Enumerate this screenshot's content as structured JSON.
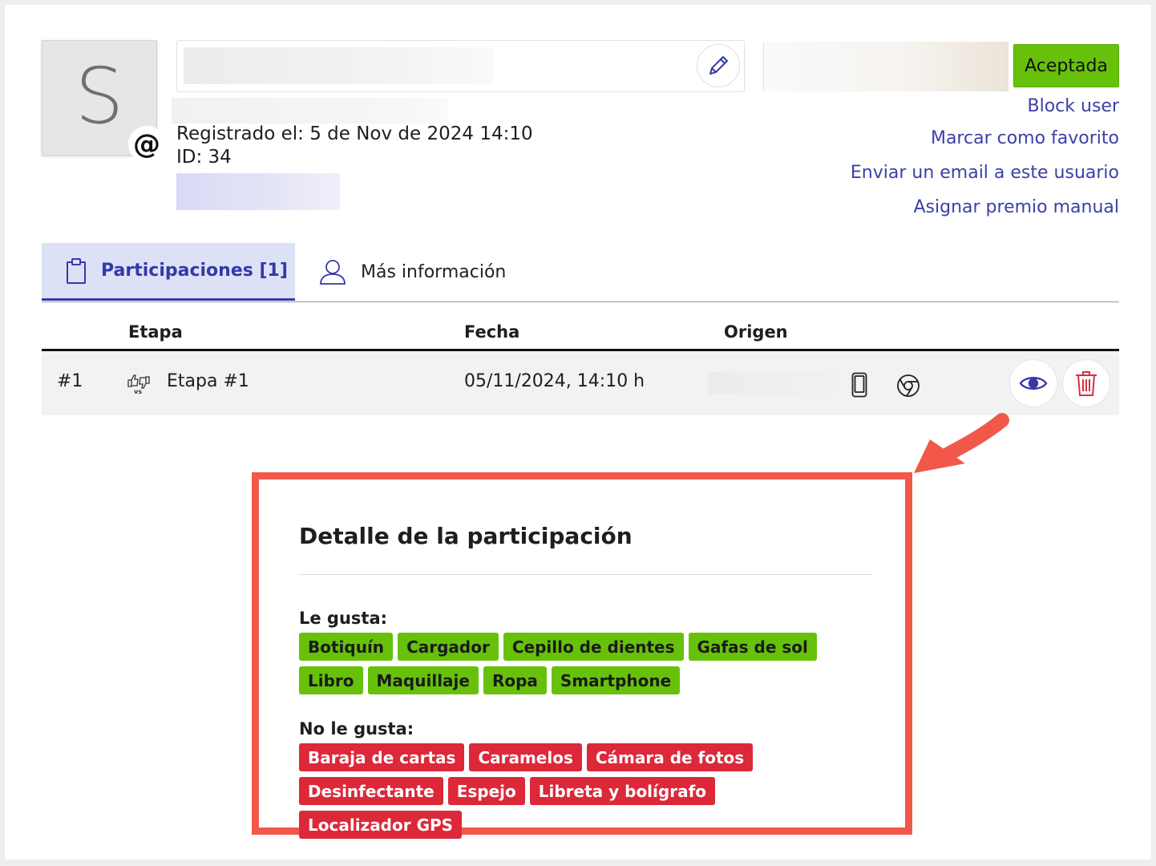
{
  "profile": {
    "avatar_letter": "S",
    "email_badge": "@",
    "registered": "Registrado el: 5 de Nov de 2024 14:10",
    "id": "ID: 34"
  },
  "status": {
    "label": "Aceptada",
    "color": "#67c10a"
  },
  "actions": [
    {
      "label": "Block user"
    },
    {
      "label": "Marcar como favorito"
    },
    {
      "label": "Enviar un email a este usuario"
    },
    {
      "label": "Asignar premio manual"
    }
  ],
  "tabs": [
    {
      "label": "Participaciones [1]",
      "icon": "clipboard-icon",
      "active": true
    },
    {
      "label": "Más información",
      "icon": "user-icon",
      "active": false
    }
  ],
  "table": {
    "headers": [
      "Etapa",
      "Fecha",
      "Origen"
    ],
    "rows": [
      {
        "index": "#1",
        "stage_icon": "vs-icon",
        "stage": "Etapa #1",
        "date": "05/11/2024, 14:10 h"
      }
    ]
  },
  "detail": {
    "title": "Detalle de la participación",
    "likes_label": "Le gusta:",
    "likes": [
      "Botiquín",
      "Cargador",
      "Cepillo de dientes",
      "Gafas de sol",
      "Libro",
      "Maquillaje",
      "Ropa",
      "Smartphone"
    ],
    "dislikes_label": "No le gusta:",
    "dislikes": [
      "Baraja de cartas",
      "Caramelos",
      "Cámara de fotos",
      "Desinfectante",
      "Espejo",
      "Libreta y bolígrafo",
      "Localizador GPS"
    ]
  },
  "colors": {
    "accent": "#3439a8",
    "like": "#67c10a",
    "dislike": "#dc2839",
    "highlight": "#f1584a"
  }
}
